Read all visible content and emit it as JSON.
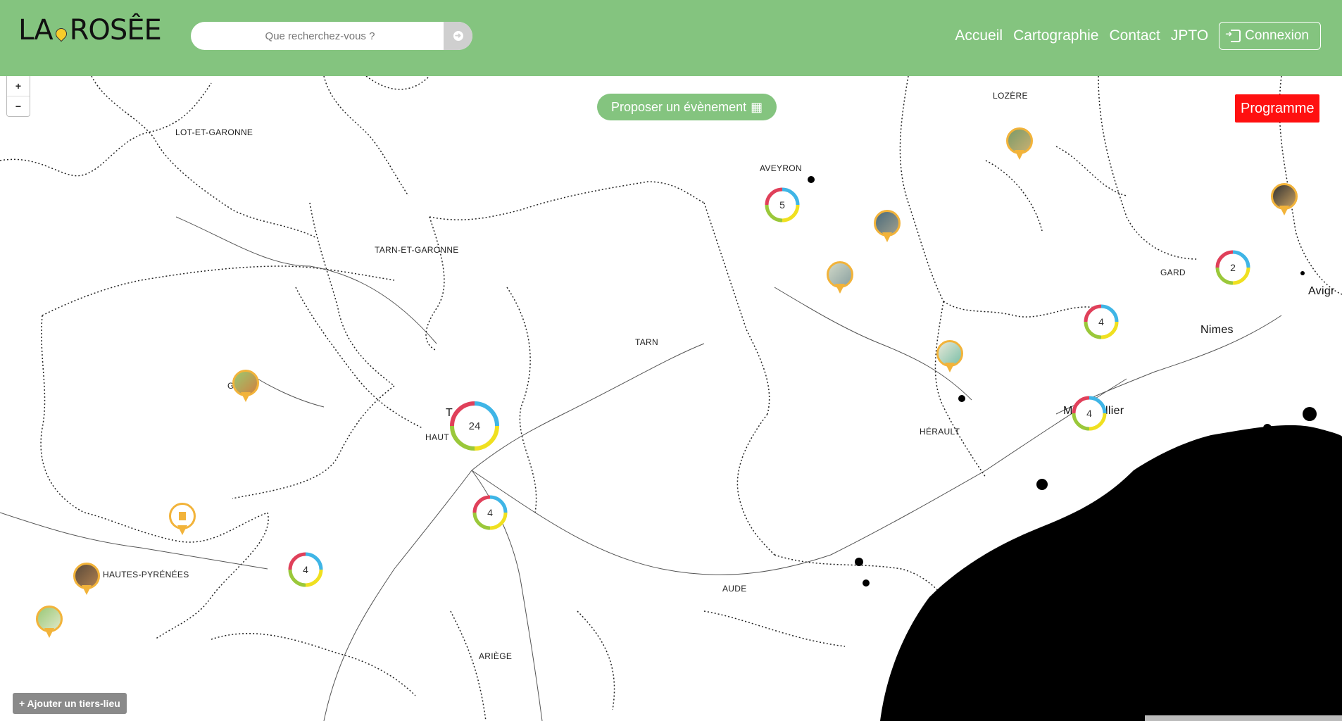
{
  "header": {
    "logo_text": "LA ROSÊE",
    "search_placeholder": "Que recherchez-vous ?",
    "nav": [
      "Accueil",
      "Cartographie",
      "Contact",
      "JPTO"
    ],
    "login_label": "Connexion"
  },
  "map": {
    "zoom_in": "+",
    "zoom_out": "−",
    "propose_event": "Proposer un évènement",
    "programme": "Programme",
    "add_place": "+ Ajouter un tiers-lieu",
    "labels": {
      "lot_et_garonne": "LOT-ET-GARONNE",
      "aveyron": "AVEYRON",
      "lozere": "LOZÈRE",
      "tarn_et_garonne": "TARN-ET-GARONNE",
      "gard": "GARD",
      "tarn": "TARN",
      "herault": "HÉRAULT",
      "hautes_pyrenees": "HAUTES-PYRÉNÉES",
      "aude": "AUDE",
      "ariege": "ARIÈGE",
      "nimes": "Nimes",
      "avignon_partial": "Avigr",
      "montpellier_left": "M",
      "montpellier_right": "llier",
      "toulouse_partial": "T",
      "haute_partial": "HAUT",
      "gers_partial": "G"
    },
    "clusters": {
      "toulouse": "24",
      "aveyron": "5",
      "gard": "2",
      "gard_south": "4",
      "montpellier": "4",
      "ariege": "4",
      "hautes_pyrenees": "4"
    },
    "colors": {
      "header": "#84c47f",
      "pin": "#f2b33a",
      "programme": "#ff1010",
      "cluster_red": "#e0405a",
      "cluster_blue": "#3fb5e6",
      "cluster_yellow": "#f0e020",
      "cluster_green": "#9ac83a"
    }
  }
}
